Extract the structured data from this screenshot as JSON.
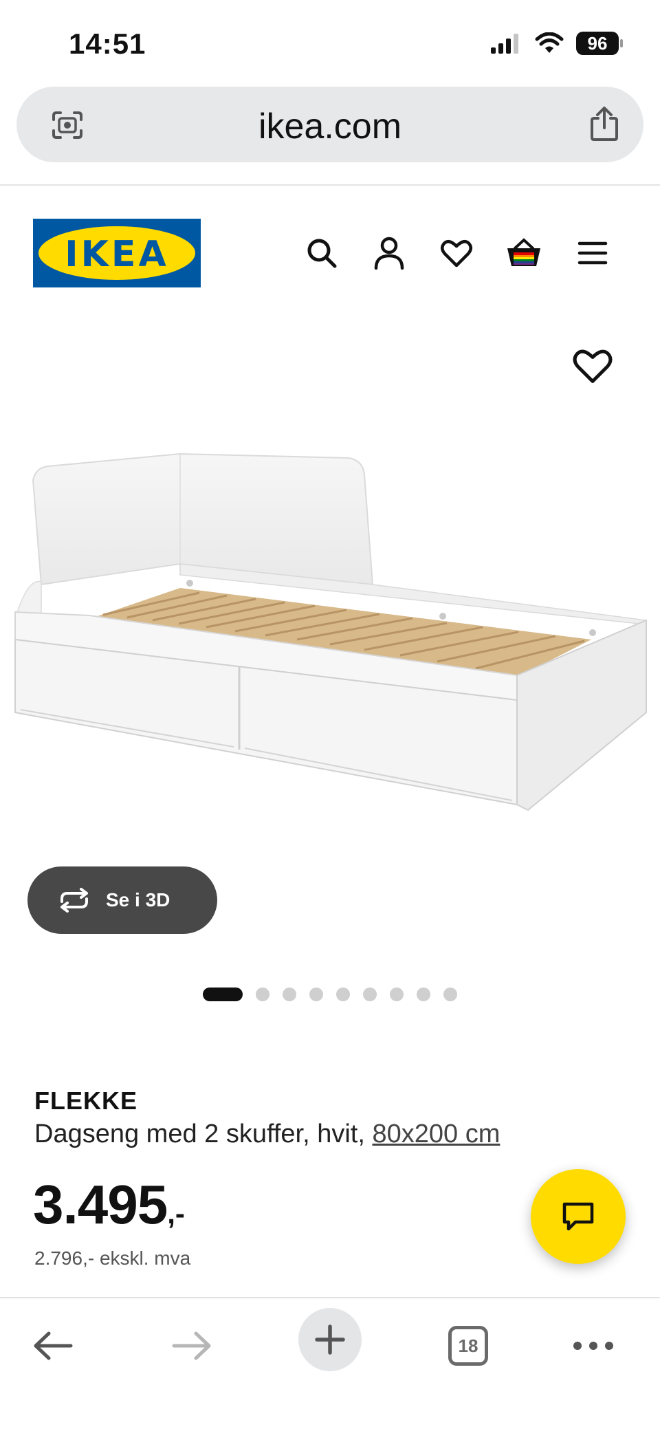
{
  "status_bar": {
    "time": "14:51",
    "battery": "96",
    "icons": [
      "signal-icon",
      "wifi-icon",
      "battery-icon"
    ]
  },
  "browser": {
    "url": "ikea.com",
    "open_tabs": "18",
    "icons": [
      "lens-icon",
      "share-icon",
      "back-icon",
      "forward-icon",
      "new-tab-icon",
      "tabs-icon",
      "more-icon"
    ]
  },
  "site_header": {
    "logo_text": "IKEA",
    "icons": [
      "search-icon",
      "account-icon",
      "wishlist-icon",
      "basket-icon",
      "menu-icon"
    ]
  },
  "gallery": {
    "view_3d_label": "Se i 3D",
    "image_count": 9,
    "active_index": 0
  },
  "product": {
    "name": "FLEKKE",
    "description": "Dagseng med 2 skuffer, hvit,",
    "size": "80x200 cm",
    "price_main": "3.495",
    "price_suffix": ",-",
    "price_ex_vat": "2.796,- ekskl. mva"
  },
  "colors": {
    "ikea_blue": "#0058a3",
    "ikea_yellow": "#ffdb00",
    "button_dark": "#484848"
  }
}
